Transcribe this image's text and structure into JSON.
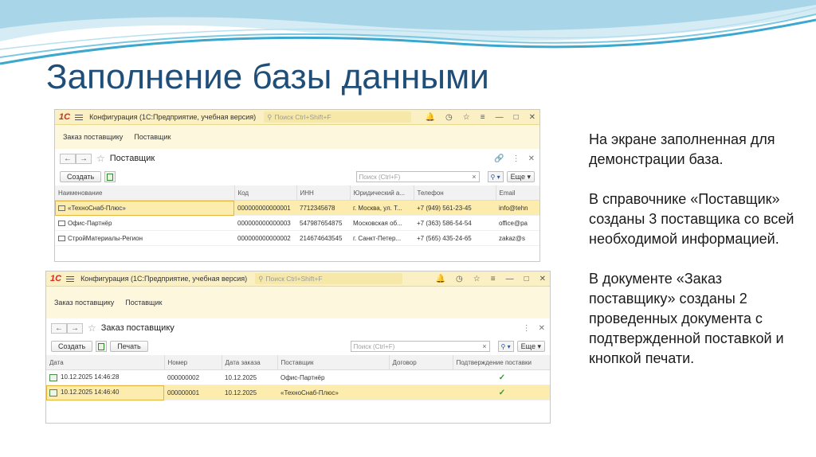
{
  "slide": {
    "title": "Заполнение базы данными",
    "paragraphs": [
      "На экране заполненная для демонстрации база.",
      "В справочнике «Поставщик» созданы 3 поставщика со всей необходимой информацией.",
      "В документе «Заказ поставщику» созданы 2 проведенных документа с подтвержденной поставкой и кнопкой печати."
    ]
  },
  "colors": {
    "title": "#1f4e79",
    "topbar": "#fbf0c4",
    "selected_row": "#fcecae",
    "check": "#2e9a33",
    "logo": "#d32b1e"
  },
  "window1": {
    "logo": "1С",
    "config_title": "Конфигурация (1С:Предприятие, учебная версия)",
    "search_placeholder": "Поиск Ctrl+Shift+F",
    "topbar_icons": [
      "bell-icon",
      "history-icon",
      "star-icon",
      "menu-icon",
      "minimize-icon",
      "maximize-icon",
      "close-icon"
    ],
    "sections": [
      "Заказ поставщику",
      "Поставщик"
    ],
    "form_title": "Поставщик",
    "create_label": "Создать",
    "list_search_placeholder": "Поиск (Ctrl+F)",
    "more_label": "Еще",
    "columns": [
      "Наименование",
      "Код",
      "ИНН",
      "Юридический а...",
      "Телефон",
      "Email"
    ],
    "rows": [
      [
        "«ТехноСнаб-Плюс»",
        "000000000000001",
        "7712345678",
        "г. Москва, ул. Т...",
        "+7 (949) 561-23-45",
        "info@tehn"
      ],
      [
        "Офис-Партнёр",
        "000000000000003",
        "547987654875",
        "Московская об...",
        "+7 (363) 586-54-54",
        "office@pa"
      ],
      [
        "СтройМатериалы-Регион",
        "000000000000002",
        "214674643545",
        "г. Санкт-Петер...",
        "+7 (565) 435-24-65",
        "zakaz@s"
      ]
    ]
  },
  "window2": {
    "logo": "1С",
    "config_title": "Конфигурация (1С:Предприятие, учебная версия)",
    "search_placeholder": "Поиск Ctrl+Shift+F",
    "topbar_icons": [
      "bell-icon",
      "history-icon",
      "star-icon",
      "menu-icon",
      "minimize-icon",
      "maximize-icon",
      "close-icon"
    ],
    "sections": [
      "Заказ поставщику",
      "Поставщик"
    ],
    "form_title": "Заказ поставщику",
    "create_label": "Создать",
    "print_label": "Печать",
    "list_search_placeholder": "Поиск (Ctrl+F)",
    "more_label": "Еще",
    "columns": [
      "Дата",
      "Номер",
      "Дата заказа",
      "Поставщик",
      "Договор",
      "Подтверждение поставки"
    ],
    "rows": [
      [
        "10.12.2025 14:46:28",
        "000000002",
        "10.12.2025",
        "Офис-Партнёр",
        "",
        "✓"
      ],
      [
        "10.12.2025 14:46:40",
        "000000001",
        "10.12.2025",
        "«ТехноСнаб-Плюс»",
        "",
        "✓"
      ]
    ]
  }
}
